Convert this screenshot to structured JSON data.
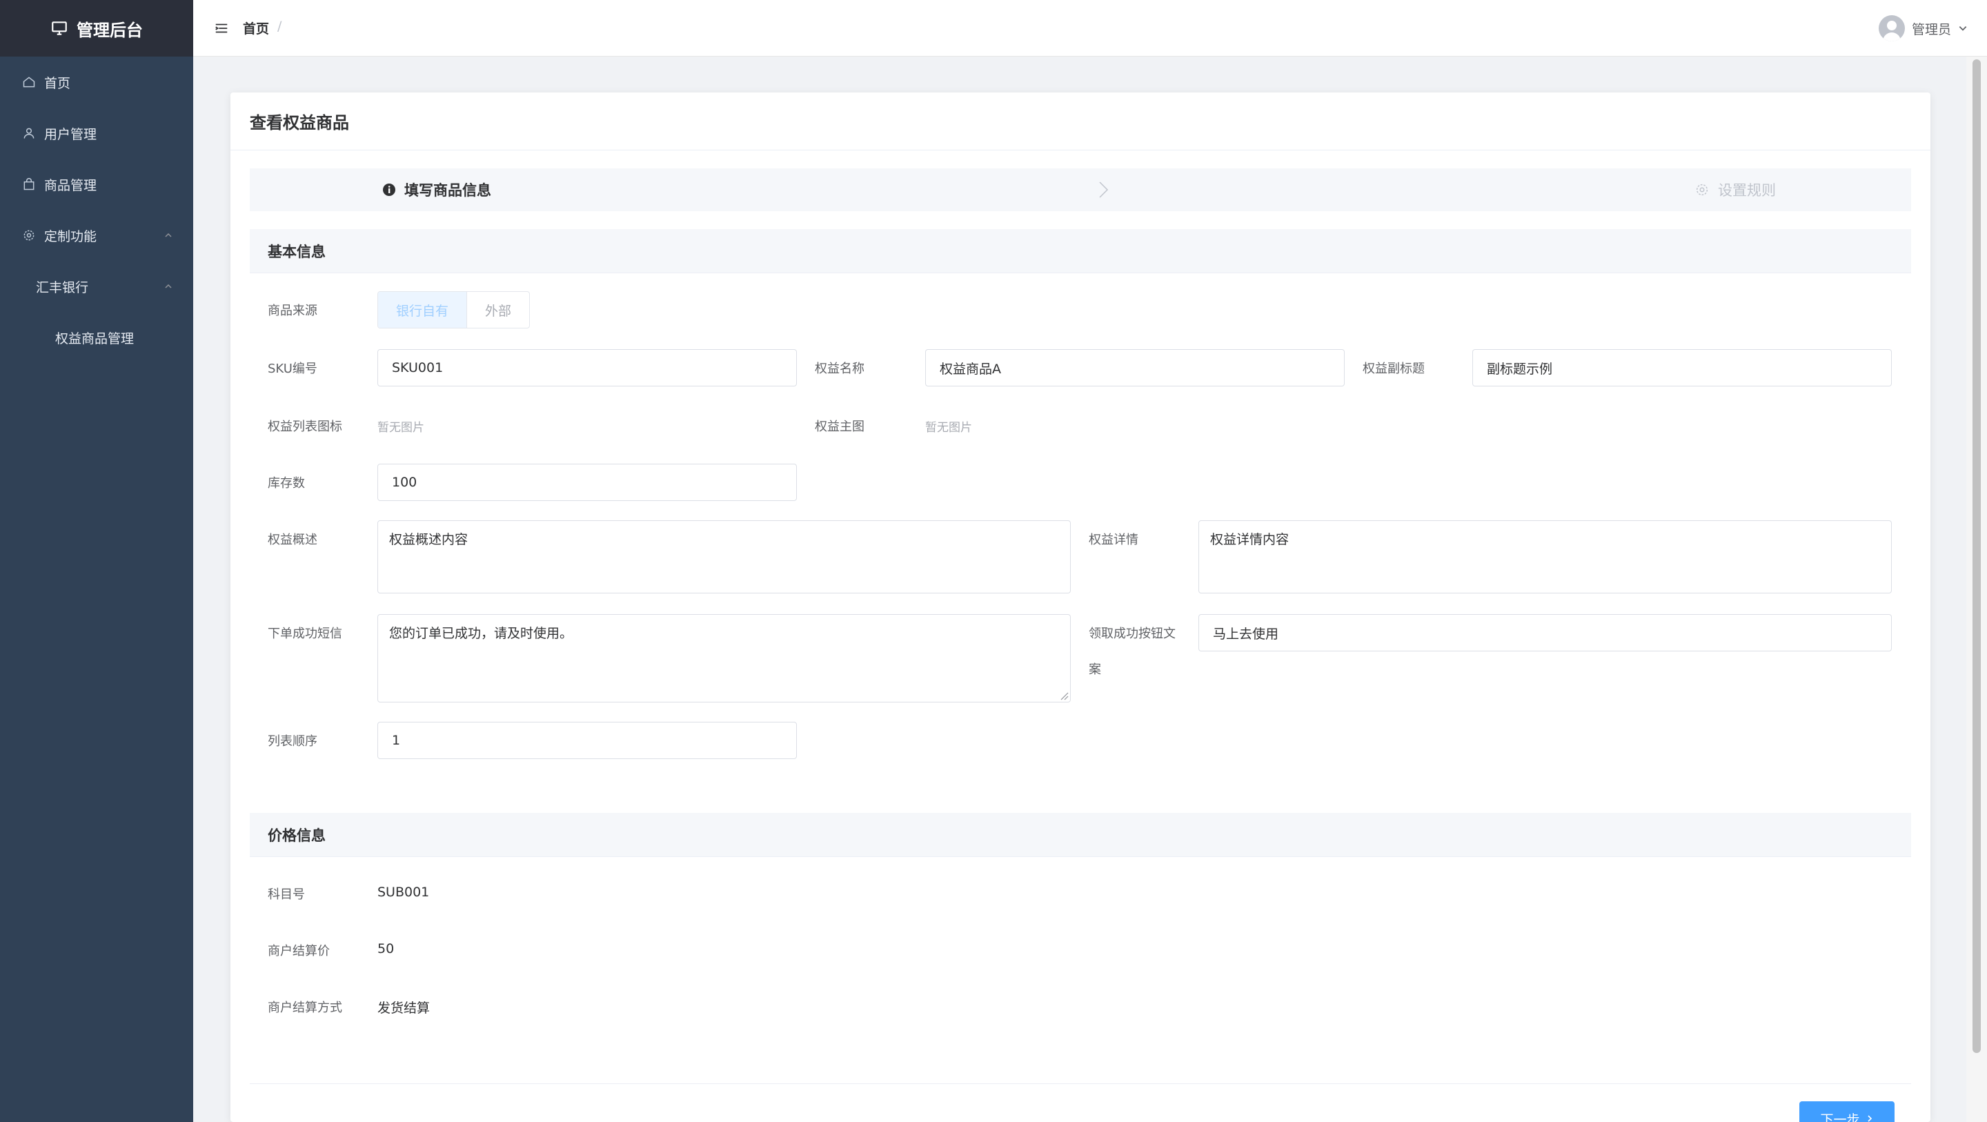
{
  "app": {
    "title": "管理后台"
  },
  "sidebar": {
    "items": [
      {
        "label": "首页",
        "icon": "home-icon"
      },
      {
        "label": "用户管理",
        "icon": "user-icon"
      },
      {
        "label": "商品管理",
        "icon": "shopping-bag-icon"
      },
      {
        "label": "定制功能",
        "icon": "gear-icon",
        "expanded": true
      },
      {
        "label": "汇丰银行",
        "expanded": true
      },
      {
        "label": "权益商品管理"
      }
    ]
  },
  "header": {
    "breadcrumb": [
      "首页",
      "/"
    ],
    "user": "管理员"
  },
  "card": {
    "title": "查看权益商品"
  },
  "steps": [
    {
      "label": "填写商品信息",
      "status": "active"
    },
    {
      "label": "设置规则",
      "status": "pending"
    }
  ],
  "basic": {
    "title": "基本信息",
    "source_label": "商品来源",
    "source_options": [
      "银行自有",
      "外部"
    ],
    "sku_label": "SKU编号",
    "sku_value": "SKU001",
    "name_label": "权益名称",
    "name_value": "权益商品A",
    "subtitle_label": "权益副标题",
    "subtitle_value": "副标题示例",
    "list_icon_label": "权益列表图标",
    "list_icon_value": "暂无图片",
    "main_img_label": "权益主图",
    "main_img_value": "暂无图片",
    "stock_label": "库存数",
    "stock_value": "100",
    "summary_label": "权益概述",
    "summary_value": "权益概述内容",
    "detail_label": "权益详情",
    "detail_value": "权益详情内容",
    "sms_label": "下单成功短信",
    "sms_value": "您的订单已成功，请及时使用。",
    "btn_text_label_1": "领取成功按钮文",
    "btn_text_label_2": "案",
    "btn_text_value": "马上去使用",
    "order_label": "列表顺序",
    "order_value": "1"
  },
  "price": {
    "title": "价格信息",
    "subject_label": "科目号",
    "subject_value": "SUB001",
    "settle_price_label": "商户结算价",
    "settle_price_value": "50",
    "settle_method_label": "商户结算方式",
    "settle_method_value": "发货结算"
  },
  "footer": {
    "next_label": "下一步"
  },
  "colors": {
    "sidebar": "#304156",
    "logo_bg": "#2b2f3a",
    "primary": "#409eff"
  }
}
